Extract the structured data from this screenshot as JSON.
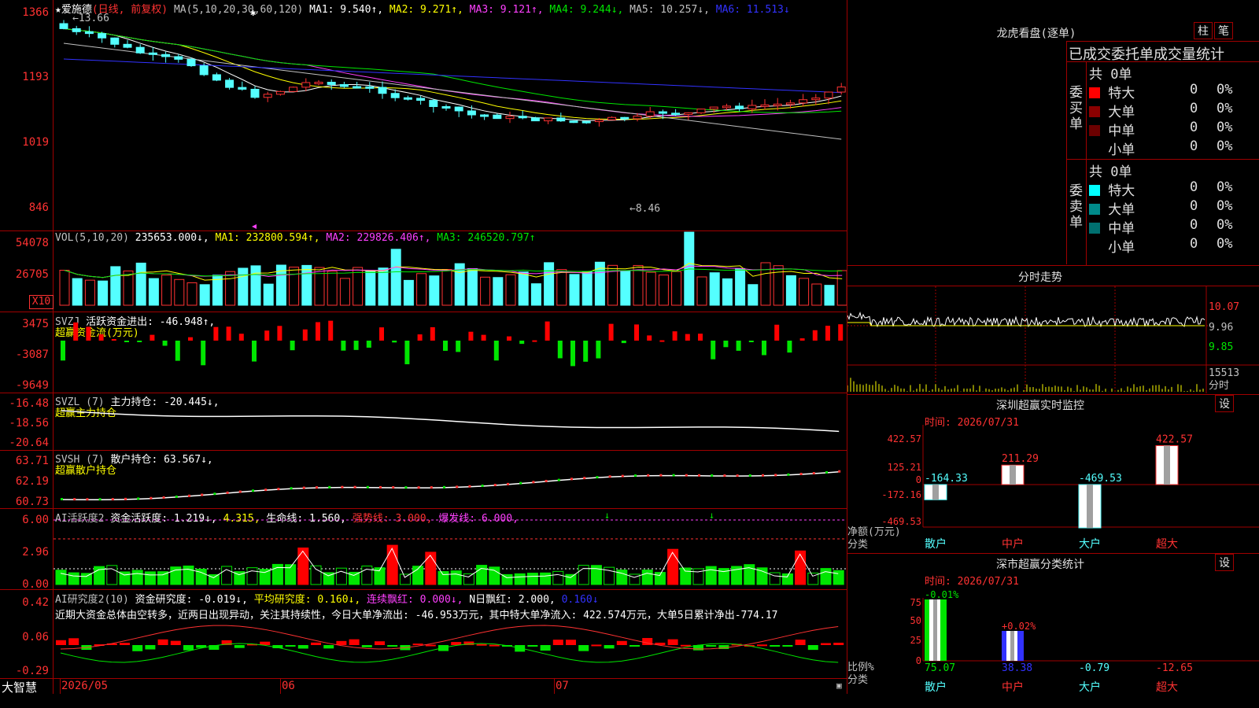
{
  "stock": {
    "name": "★爱施德",
    "mode": "(日线, 前复权)",
    "ma_params": "MA(5,10,20,30,60,120)",
    "ma1": "MA1: 9.540↑,",
    "ma2": "MA2: 9.271↑,",
    "ma3": "MA3: 9.121↑,",
    "ma4": "MA4: 9.244↓,",
    "ma5": "MA5: 10.257↓,",
    "ma6": "MA6: 11.513↓",
    "high_marker": "13.66",
    "low_marker": "8.46"
  },
  "price_axis": [
    "1366",
    "1193",
    "1019",
    "846"
  ],
  "vol_panel": {
    "header": "VOL(5,10,20)",
    "vol_val": "235653.000↓,",
    "ma1": "MA1: 232800.594↑,",
    "ma2": "MA2: 229826.406↑,",
    "ma3": "MA3: 246520.797↑",
    "axis": [
      "54078",
      "26705"
    ],
    "unit": "X10"
  },
  "svzj_panel": {
    "header": "SVZJ",
    "active": "活跃资金进出: -46.948↑,",
    "sub": "超赢资金流(万元)",
    "axis": [
      "3475",
      "-3087",
      "-9649"
    ]
  },
  "svzl_panel": {
    "header": "SVZL (7)",
    "main": "主力持仓: -20.445↓,",
    "sub": "超赢主力持仓",
    "axis": [
      "-16.48",
      "-18.56",
      "-20.64"
    ]
  },
  "svsh_panel": {
    "header": "SVSH (7)",
    "main": "散户持仓: 63.567↓,",
    "sub": "超赢散户持仓",
    "axis": [
      "63.71",
      "62.19",
      "60.73"
    ]
  },
  "ai_active": {
    "header": "AI活跃度2",
    "active": "资金活跃度: 1.219↓,",
    "v2": "4.315,",
    "life": "生命线: 1.560,",
    "strong": "强势线: 3.000,",
    "burst": "爆发线: 6.000,",
    "axis": [
      "6.00",
      "2.96",
      "0.00"
    ]
  },
  "ai_research": {
    "header": "AI研究度2(10)",
    "research": "资金研究度: -0.019↓,",
    "avg": "平均研究度: 0.160↓,",
    "cont": "连续飘红: 0.000↓,",
    "nday": "N日飘红: 2.000,",
    "last": "0.160↓",
    "comment": "近期大资金总体由空转多，近两日出现异动，关注其持续性，今日大单净流出: -46.953万元，其中特大单净流入: 422.574万元，大单5日累计净出-774.17",
    "axis": [
      "0.42",
      "0.06",
      "-0.29"
    ]
  },
  "date_axis": {
    "brand": "大智慧",
    "labels": [
      "2026/05",
      "06",
      "07"
    ]
  },
  "right_panel": {
    "dragon_title": "龙虎看盘(逐单)",
    "btn_zhu": "柱",
    "btn_bi": "笔",
    "deal_title": "已成交委托单成交量统计",
    "buy_label": "委买单",
    "sell_label": "委卖单",
    "buy_total": "共 0单",
    "sell_total": "共 0单",
    "buy_rows": [
      {
        "name": "特大",
        "count": "0",
        "pct": "0%",
        "color": "#ff0000"
      },
      {
        "name": "大单",
        "count": "0",
        "pct": "0%",
        "color": "#8b0000"
      },
      {
        "name": "中单",
        "count": "0",
        "pct": "0%",
        "color": "#6b0000"
      },
      {
        "name": "小单",
        "count": "0",
        "pct": "0%",
        "color": ""
      }
    ],
    "sell_rows": [
      {
        "name": "特大",
        "count": "0",
        "pct": "0%",
        "color": "#00ffff"
      },
      {
        "name": "大单",
        "count": "0",
        "pct": "0%",
        "color": "#008b8b"
      },
      {
        "name": "中单",
        "count": "0",
        "pct": "0%",
        "color": "#007070"
      },
      {
        "name": "小单",
        "count": "0",
        "pct": "0%",
        "color": ""
      }
    ],
    "intraday_title": "分时走势",
    "intraday_axis": [
      "10.07",
      "9.96",
      "9.85"
    ],
    "intraday_vol": "15513",
    "intraday_vol_unit": "分时",
    "sz_monitor_title": "深圳超赢实时监控",
    "sz_btn": "设",
    "sz_time": "时间: 2026/07/31",
    "sz_axis": [
      "422.57",
      "125.21",
      "0",
      "-172.16",
      "-469.53"
    ],
    "sz_values": [
      "-164.33",
      "211.29",
      "-469.53",
      "422.57"
    ],
    "sz_ylabel": "净额(万元)",
    "sz_cat_label": "分类",
    "categories": [
      "散户",
      "中户",
      "大户",
      "超大"
    ],
    "sz_cls_title": "深市超赢分类统计",
    "cls_btn": "设",
    "cls_time": "时间: 2026/07/31",
    "cls_axis": [
      "75",
      "50",
      "25",
      "0"
    ],
    "cls_top": [
      "-0.01%",
      "+0.02%"
    ],
    "cls_values": [
      "75.07",
      "38.38",
      "-0.79",
      "-12.65"
    ],
    "cls_ylabel": "比例%",
    "cls_cat_label": "分类"
  }
}
